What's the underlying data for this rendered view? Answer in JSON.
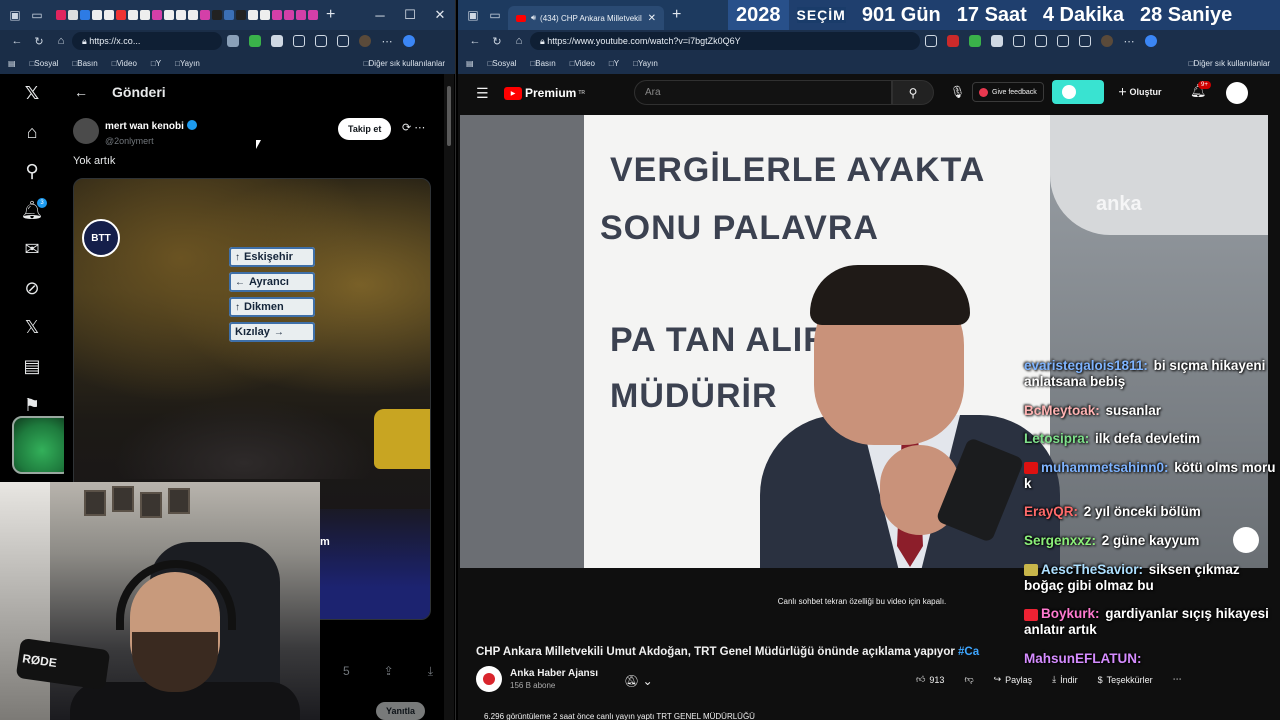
{
  "countdown": {
    "year": "2028",
    "label": "SEÇİM",
    "days": "901 Gün",
    "hours": "17 Saat",
    "minutes": "4 Dakika",
    "seconds": "28 Saniye"
  },
  "left_browser": {
    "url": "https://x.co...",
    "bookmarks": [
      "Sosyal",
      "Basın",
      "Video",
      "Y",
      "Yayın"
    ],
    "bookmarks_right": "Diğer sık kullanılanlar"
  },
  "right_browser": {
    "tab_title": "(434) CHP Ankara Milletvekil",
    "url": "https://www.youtube.com/watch?v=i7bgtZk0Q6Y",
    "bookmarks": [
      "Sosyal",
      "Basın",
      "Video",
      "Y",
      "Yayın"
    ],
    "bookmarks_right": "Diğer sık kullanılanlar"
  },
  "x": {
    "header_title": "Gönderi",
    "author_name": "mert wan kenobi",
    "author_handle": "@2onlymert",
    "follow_label": "Takip et",
    "tweet_text": "Yok artık",
    "notif_count": "3",
    "media_badge": "BTT",
    "media_caption_fragment": "m",
    "reply_label": "Yanıtla",
    "signs": [
      "Eskişehir",
      "Ayrancı",
      "Dikmen",
      "Kızılay"
    ],
    "action_count": "5"
  },
  "webcam": {
    "mic_brand": "RØDE"
  },
  "youtube": {
    "logo": "Premium",
    "logo_sup": "TR",
    "search_placeholder": "Ara",
    "feedback_label": "Give feedback",
    "create_label": "Oluştur",
    "notif_badge": "9+",
    "banner_lines": [
      "VERGİLERLE AYAKTA",
      "SONU       PALAVRA",
      "PA            TAN ALIR",
      "                    MÜDÜRİR"
    ],
    "watermark": "anka",
    "chat_disabled": "Canlı sohbet tekran özelliği bu video için kapalı.",
    "title": "CHP Ankara Milletvekili Umut Akdoğan, TRT Genel Müdürlüğü önünde açıklama yapıyor ",
    "title_tag": "#Ca",
    "channel_name": "Anka Haber Ajansı",
    "channel_subs": "156 B abone",
    "likes": "913",
    "share_label": "Paylaş",
    "download_label": "İndir",
    "thanks_label": "Teşekkürler",
    "views_line": "6.296 görüntüleme  2 saat önce canlı yayın yaptı  TRT GENEL MÜDÜRLÜĞÜ"
  },
  "chat_messages": [
    {
      "user": "evaristegalois1811:",
      "text": " bi sıçma hikayeni anlatsana bebiş",
      "color": "#7fb4ff"
    },
    {
      "user": "BcMeytoak:",
      "text": " susanlar",
      "color": "#ffb3b3"
    },
    {
      "user": "Letosipra:",
      "text": " ilk defa devletim",
      "color": "#7ee08a"
    },
    {
      "user": "muhammetsahinn0:",
      "text": " kötü olms moru k",
      "color": "#7fb4ff",
      "emote": "#d11"
    },
    {
      "user": "ErayQR:",
      "text": " 2 yıl önceki bölüm",
      "color": "#ff6a6a"
    },
    {
      "user": "Sergenxxz:",
      "text": " 2 güne kayyum",
      "color": "#8cf07a"
    },
    {
      "user": "AescTheSavior:",
      "text": " siksen çıkmaz boğaç gibi olmaz bu",
      "color": "#aee0ff",
      "emote": "#c8b64a"
    },
    {
      "user": "Boykurk:",
      "text": " gardiyanlar sıçış hikayesi anlatır artık",
      "color": "#ff7ad0",
      "emote": "#e23"
    },
    {
      "user": "MahsunEFLATUN:",
      "text": " ",
      "color": "#d58cff"
    }
  ]
}
